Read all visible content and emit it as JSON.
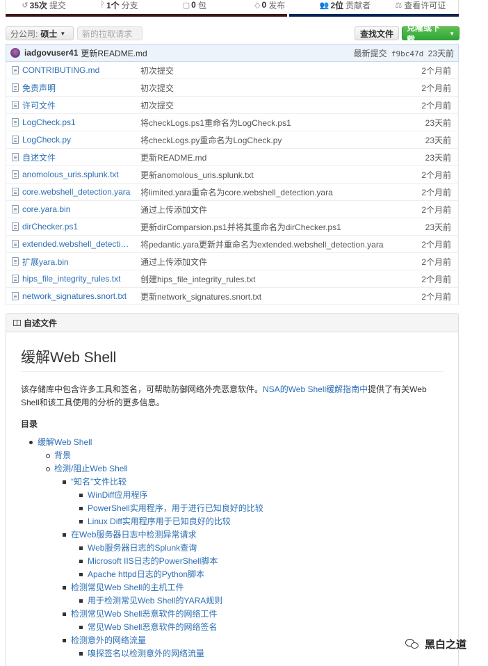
{
  "numbers": {
    "commits": {
      "count": "35次",
      "label": "提交"
    },
    "branches": {
      "count": "1个",
      "label": "分支"
    },
    "packages": {
      "count": "0",
      "label": "包"
    },
    "releases": {
      "count": "0",
      "label": "发布"
    },
    "contributors": {
      "count": "2位",
      "label": "贡献者"
    },
    "license": {
      "label": "查看许可证"
    }
  },
  "toolbar": {
    "branch_prefix": "分公司:",
    "branch_name": "硕士",
    "new_pr": "新的拉取请求",
    "find_file": "查找文件",
    "clone": "克隆或下载"
  },
  "latest_commit": {
    "user": "iadgovuser41",
    "message": "更新README.md",
    "prefix": "最新提交",
    "sha": "f9bc47d",
    "age": "23天前"
  },
  "files": [
    {
      "name": "CONTRIBUTING.md",
      "message": "初次提交",
      "age": "2个月前"
    },
    {
      "name": "免责声明",
      "message": "初次提交",
      "age": "2个月前"
    },
    {
      "name": "许可文件",
      "message": "初次提交",
      "age": "2个月前"
    },
    {
      "name": "LogCheck.ps1",
      "message": "将checkLogs.ps1重命名为LogCheck.ps1",
      "age": "23天前"
    },
    {
      "name": "LogCheck.py",
      "message": "将checkLogs.py重命名为LogCheck.py",
      "age": "23天前"
    },
    {
      "name": "自述文件",
      "message": "更新README.md",
      "age": "23天前"
    },
    {
      "name": "anomolous_uris.splunk.txt",
      "message": "更新anomolous_uris.splunk.txt",
      "age": "2个月前"
    },
    {
      "name": "core.webshell_detection.yara",
      "message": "将limited.yara重命名为core.webshell_detection.yara",
      "age": "2个月前"
    },
    {
      "name": "core.yara.bin",
      "message": "通过上传添加文件",
      "age": "2个月前"
    },
    {
      "name": "dirChecker.ps1",
      "message": "更新dirComparsion.ps1并将其重命名为dirChecker.ps1",
      "age": "23天前"
    },
    {
      "name": "extended.webshell_detecti…",
      "message": "将pedantic.yara更新并重命名为extended.webshell_detection.yara",
      "age": "2个月前"
    },
    {
      "name": "扩展yara.bin",
      "message": "通过上传添加文件",
      "age": "2个月前"
    },
    {
      "name": "hips_file_integrity_rules.txt",
      "message": "创建hips_file_integrity_rules.txt",
      "age": "2个月前"
    },
    {
      "name": "network_signatures.snort.txt",
      "message": "更新network_signatures.snort.txt",
      "age": "2个月前"
    }
  ],
  "readme": {
    "header": "自述文件",
    "title": "缓解Web Shell",
    "intro_before": "该存储库中包含许多工具和签名，可帮助防御网络外壳恶意软件。",
    "intro_link": "NSA的Web Shell缓解指南中",
    "intro_after": "提供了有关Web Shell和该工具使用的分析的更多信息。",
    "toc_title": "目录",
    "toc": [
      {
        "level": 1,
        "text": "缓解Web Shell"
      },
      {
        "level": 2,
        "text": "背景"
      },
      {
        "level": 2,
        "text": "检测/阻止Web Shell"
      },
      {
        "level": 3,
        "text": "“知名”文件比较"
      },
      {
        "level": 4,
        "text": "WinDiff应用程序"
      },
      {
        "level": 4,
        "text": "PowerShell实用程序，用于进行已知良好的比较"
      },
      {
        "level": 4,
        "text": "Linux Diff实用程序用于已知良好的比较"
      },
      {
        "level": 3,
        "text": "在Web服务器日志中检测异常请求"
      },
      {
        "level": 4,
        "text": "Web服务器日志的Splunk查询"
      },
      {
        "level": 4,
        "text": "Microsoft IIS日志的PowerShell脚本"
      },
      {
        "level": 4,
        "text": "Apache httpd日志的Python脚本"
      },
      {
        "level": 3,
        "text": "检测常见Web Shell的主机工件"
      },
      {
        "level": 4,
        "text": "用于检测常见Web Shell的YARA规则"
      },
      {
        "level": 3,
        "text": "检测常见Web Shell恶意软件的网络工件"
      },
      {
        "level": 4,
        "text": "常见Web Shell恶意软件的网络签名"
      },
      {
        "level": 3,
        "text": "检测意外的网络流量"
      },
      {
        "level": 4,
        "text": "嗅探签名以检测意外的网络流量"
      }
    ]
  },
  "watermark": {
    "text": "黑白之道"
  },
  "colors": {
    "link": "#2d6fb5",
    "clone_button": "#34a83c",
    "commit_bar": "#edf3fb",
    "lang_bar_1": "#3e1416",
    "lang_bar_2": "#012456"
  }
}
